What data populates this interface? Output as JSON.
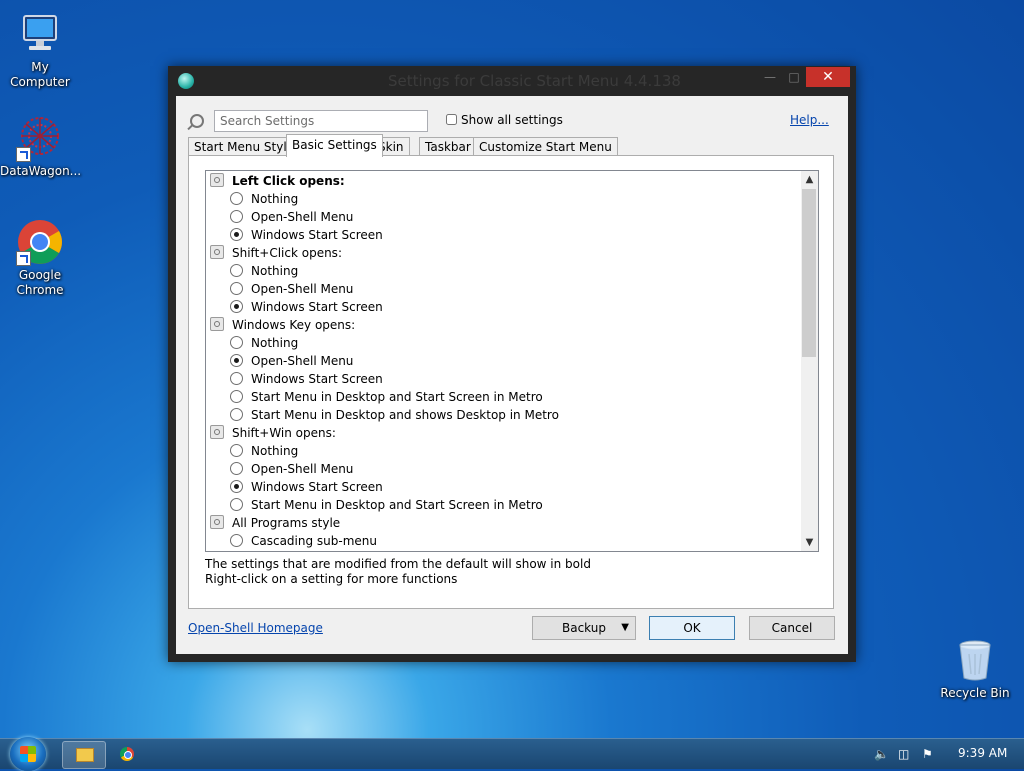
{
  "desktop": {
    "icons": [
      {
        "label": "My Computer"
      },
      {
        "label": "DataWagon..."
      },
      {
        "label": "Google Chrome"
      },
      {
        "label": "Recycle Bin"
      }
    ]
  },
  "window": {
    "title": "Settings for Classic Start Menu 4.4.138",
    "search_placeholder": "Search Settings",
    "show_all_label": "Show all settings",
    "help_label": "Help...",
    "tabs": [
      {
        "label": "Start Menu Style",
        "active": false
      },
      {
        "label": "Basic Settings",
        "active": true
      },
      {
        "label": "Skin",
        "active": false
      },
      {
        "label": "Taskbar",
        "active": false
      },
      {
        "label": "Customize Start Menu",
        "active": false
      }
    ],
    "settings": [
      {
        "kind": "group",
        "label": "Left Click opens:",
        "bold": true
      },
      {
        "kind": "option",
        "label": "Nothing",
        "checked": false
      },
      {
        "kind": "option",
        "label": "Open-Shell Menu",
        "checked": false
      },
      {
        "kind": "option",
        "label": "Windows Start Screen",
        "checked": true
      },
      {
        "kind": "group",
        "label": "Shift+Click opens:",
        "bold": false
      },
      {
        "kind": "option",
        "label": "Nothing",
        "checked": false
      },
      {
        "kind": "option",
        "label": "Open-Shell Menu",
        "checked": false
      },
      {
        "kind": "option",
        "label": "Windows Start Screen",
        "checked": true
      },
      {
        "kind": "group",
        "label": "Windows Key opens:",
        "bold": false
      },
      {
        "kind": "option",
        "label": "Nothing",
        "checked": false
      },
      {
        "kind": "option",
        "label": "Open-Shell Menu",
        "checked": true
      },
      {
        "kind": "option",
        "label": "Windows Start Screen",
        "checked": false
      },
      {
        "kind": "option",
        "label": "Start Menu in Desktop and Start Screen in Metro",
        "checked": false
      },
      {
        "kind": "option",
        "label": "Start Menu in Desktop and shows Desktop in Metro",
        "checked": false
      },
      {
        "kind": "group",
        "label": "Shift+Win opens:",
        "bold": false
      },
      {
        "kind": "option",
        "label": "Nothing",
        "checked": false
      },
      {
        "kind": "option",
        "label": "Open-Shell Menu",
        "checked": false
      },
      {
        "kind": "option",
        "label": "Windows Start Screen",
        "checked": true
      },
      {
        "kind": "option",
        "label": "Start Menu in Desktop and Start Screen in Metro",
        "checked": false
      },
      {
        "kind": "group",
        "label": "All Programs style",
        "bold": false
      },
      {
        "kind": "option",
        "label": "Cascading sub-menu",
        "checked": false
      }
    ],
    "info_line1": "The settings that are modified from the default will show in bold",
    "info_line2": "Right-click on a setting for more functions",
    "homepage_link": "Open-Shell Homepage",
    "backup_label": "Backup",
    "ok_label": "OK",
    "cancel_label": "Cancel"
  },
  "taskbar": {
    "clock": "9:39 AM"
  }
}
